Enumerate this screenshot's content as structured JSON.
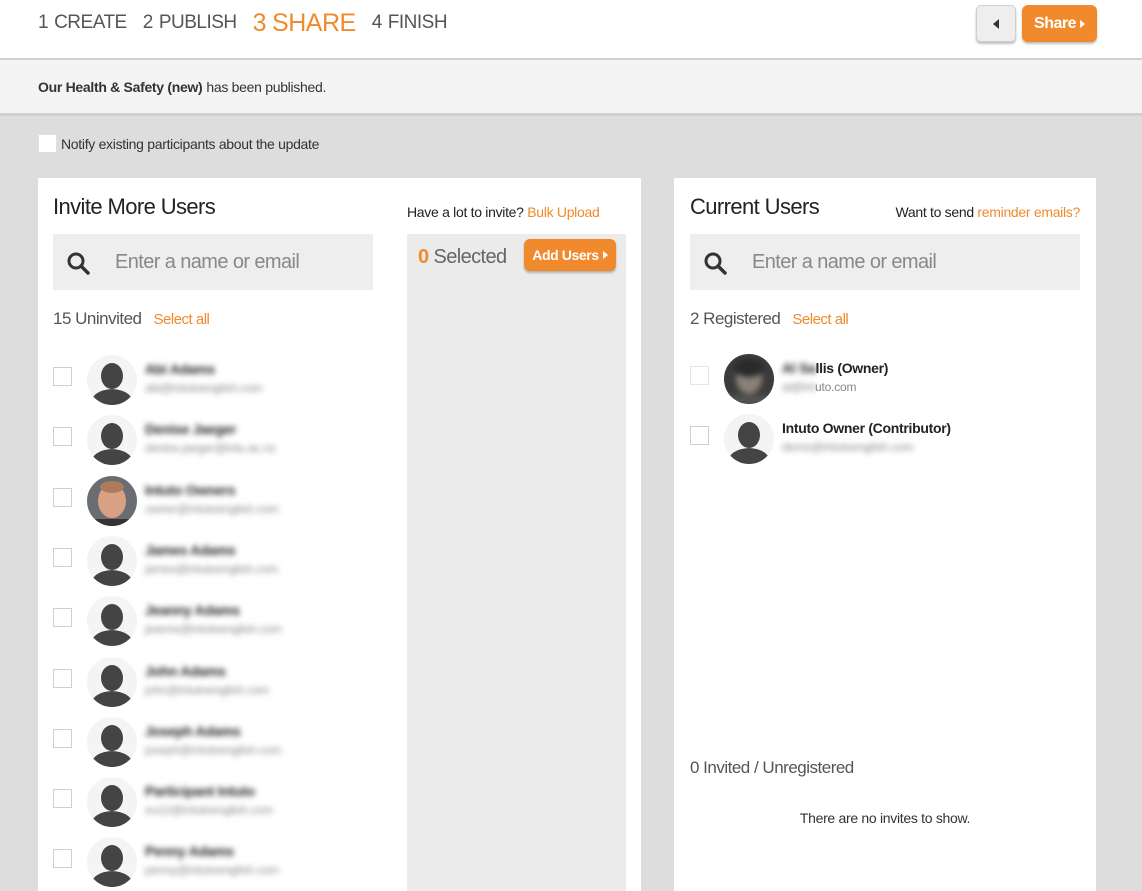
{
  "steps": [
    {
      "num": "1",
      "label": "CREATE"
    },
    {
      "num": "2",
      "label": "PUBLISH"
    },
    {
      "num": "3",
      "label": "SHARE"
    },
    {
      "num": "4",
      "label": "FINISH"
    }
  ],
  "toolbar": {
    "share_label": "Share"
  },
  "notice": {
    "name": "Our Health & Safety (new)",
    "text": "has been published."
  },
  "notify": {
    "label": "Notify existing participants about the update"
  },
  "invite": {
    "title": "Invite More Users",
    "bulk_prefix": "Have a lot to invite?",
    "bulk_link": "Bulk Upload",
    "search_placeholder": "Enter a name or email",
    "count_label": "15 Uninvited",
    "select_all": "Select all",
    "users": [
      {
        "name": "Abi Adams",
        "email": "abi@intutoenglish.com",
        "photo": false
      },
      {
        "name": "Denise Jaeger",
        "email": "denise.jaeger@intu.ac.nz",
        "photo": false
      },
      {
        "name": "Intuto Owners",
        "email": "owner@intutoenglish.com",
        "photo": true
      },
      {
        "name": "James Adams",
        "email": "james@intutoenglish.com",
        "photo": false
      },
      {
        "name": "Jeanny Adams",
        "email": "jeanne@intutoenglish.com",
        "photo": false
      },
      {
        "name": "John Adams",
        "email": "john@intutoenglish.com",
        "photo": false
      },
      {
        "name": "Joseph Adams",
        "email": "joseph@intutoenglish.com",
        "photo": false
      },
      {
        "name": "Participant Intuto",
        "email": "eu12@intutoenglish.com",
        "photo": false
      },
      {
        "name": "Penny Adams",
        "email": "penny@intutoenglish.com",
        "photo": false
      }
    ]
  },
  "selected": {
    "count": "0",
    "label": "Selected",
    "add_label": "Add Users"
  },
  "current": {
    "title": "Current Users",
    "reminder_prefix": "Want to send",
    "reminder_link": "reminder emails?",
    "search_placeholder": "Enter a name or email",
    "count_label": "2 Registered",
    "select_all": "Select all",
    "users": [
      {
        "name_hidden": "Al Sa",
        "name_visible": "llis (Owner)",
        "email_hidden": "al@int",
        "email_visible": "uto.com",
        "photo": true
      },
      {
        "name_hidden": "",
        "name_visible": "Intuto Owner (Contributor)",
        "email_hidden": "demo@intutoenglish.com",
        "email_visible": "",
        "photo": false
      }
    ],
    "invited_title": "0 Invited / Unregistered",
    "no_invites": "There are no invites to show."
  },
  "colors": {
    "accent": "#f08a2c",
    "panel_bg": "#ffffff",
    "page_bg": "#dddddd"
  },
  "icons": {
    "search": "search-icon",
    "back": "caret-left-icon",
    "avatar": "user-silhouette-icon"
  }
}
